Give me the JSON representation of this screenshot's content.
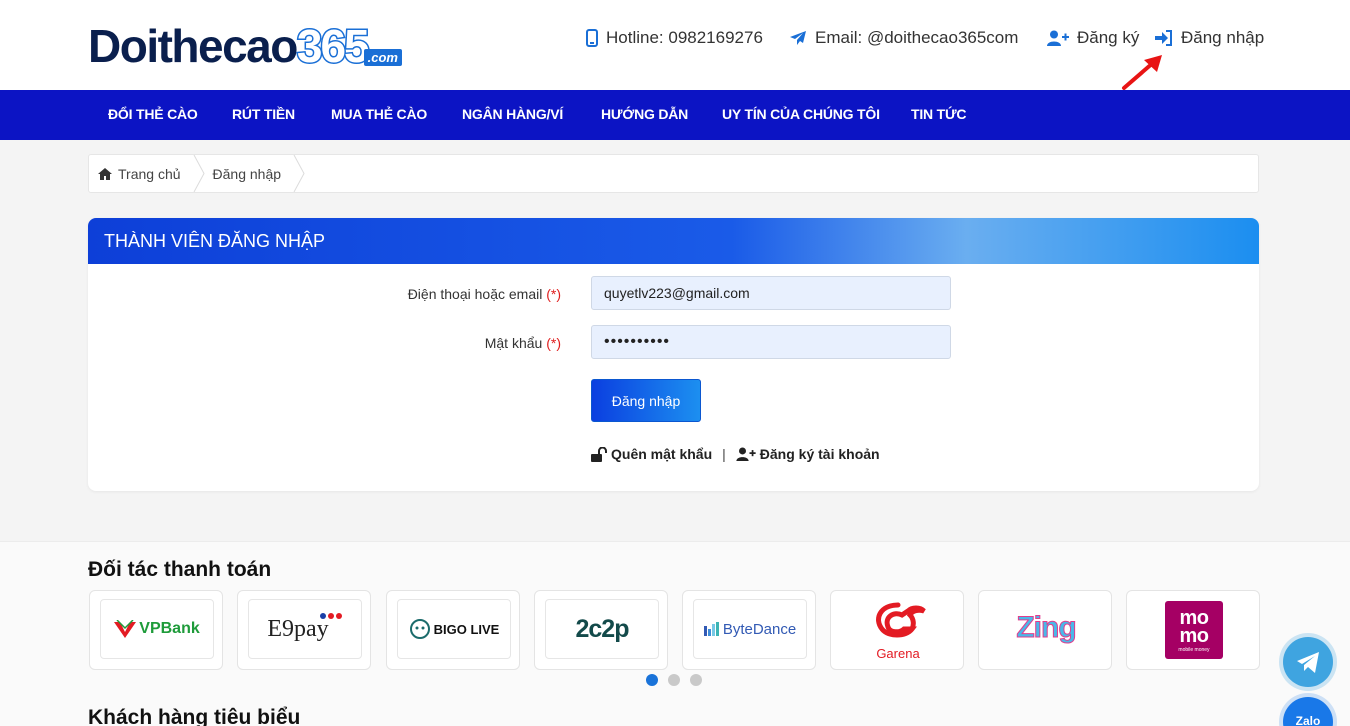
{
  "logo": {
    "text": "Doithecao",
    "number": "365",
    "suffix": ".com"
  },
  "header": {
    "hotline": "Hotline: 0982169276",
    "email": "Email: @doithecao365com",
    "register": "Đăng ký",
    "login": "Đăng nhập"
  },
  "nav": {
    "items": [
      "ĐỔI THẺ CÀO",
      "RÚT TIỀN",
      "MUA THẺ CÀO",
      "NGÂN HÀNG/VÍ",
      "HƯỚNG DẪN",
      "UY TÍN CỦA CHÚNG TÔI",
      "TIN TỨC"
    ]
  },
  "breadcrumb": {
    "home": "Trang chủ",
    "current": "Đăng nhập"
  },
  "login_form": {
    "title": "THÀNH VIÊN ĐĂNG NHẬP",
    "phone_label": "Điện thoại hoặc email",
    "password_label": "Mật khẩu",
    "required_mark": "(*)",
    "phone_value": "quyetlv223@gmail.com",
    "password_value": "••••••••••",
    "submit": "Đăng nhập",
    "forgot": "Quên mật khẩu",
    "separator": "|",
    "create_account": "Đăng ký tài khoản"
  },
  "partners": {
    "title": "Đối tác thanh toán",
    "items": [
      "VPBank",
      "E9pay",
      "BIGO LIVE",
      "2c2p",
      "ByteDance",
      "Garena",
      "Zing",
      "momo"
    ],
    "momo_tagline": "mobile money",
    "next_title": "Khách hàng tiêu biểu"
  },
  "floating": {
    "zalo": "Zalo"
  },
  "colors": {
    "nav_bg": "#0c14c4",
    "brand": "#1a6fd6",
    "required": "#e02020"
  }
}
